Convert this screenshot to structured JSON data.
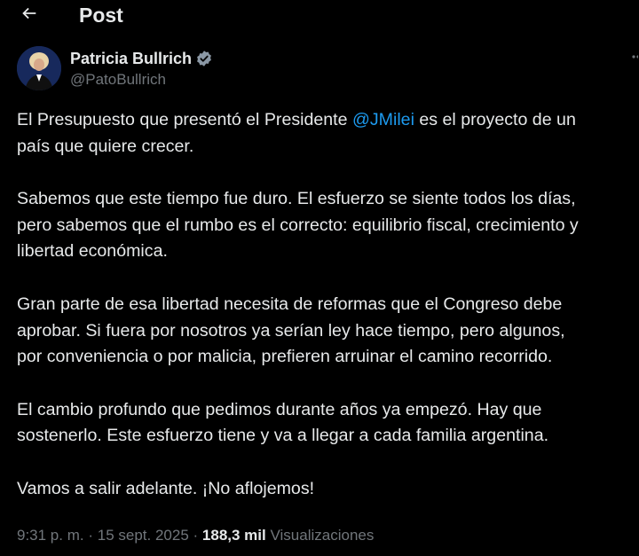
{
  "header": {
    "title": "Post",
    "back_icon": "arrow-left-icon"
  },
  "author": {
    "name": "Patricia Bullrich",
    "handle": "@PatoBullrich",
    "verified_icon": "verified-badge-icon",
    "more_icon": "more-options-icon"
  },
  "post": {
    "p1_before": "El Presupuesto que presentó el Presidente ",
    "p1_mention": "@JMilei",
    "p1_after": " es el proyecto de un",
    "p1_line2": "país que quiere crecer.",
    "p2_line1": "Sabemos que este tiempo fue duro. El esfuerzo se siente todos los días,",
    "p2_line2": "pero sabemos que el rumbo es el correcto: equilibrio fiscal, crecimiento y",
    "p2_line3": "libertad económica.",
    "p3_line1": "Gran parte de esa libertad necesita de reformas que el Congreso debe",
    "p3_line2": "aprobar. Si fuera por nosotros ya serían ley hace tiempo, pero algunos,",
    "p3_line3": "por conveniencia o por malicia, prefieren arruinar el camino recorrido.",
    "p4_line1": "El cambio profundo que pedimos durante años ya empezó. Hay que",
    "p4_line2": "sostenerlo. Este esfuerzo tiene y va a llegar a cada familia argentina.",
    "p5_line1": "Vamos a salir adelante. ¡No aflojemos!"
  },
  "meta": {
    "time": "9:31 p. m.",
    "separator": "·",
    "date": "15 sept. 2025",
    "views_count": "188,3 mil",
    "views_label": "Visualizaciones"
  },
  "colors": {
    "background": "#000000",
    "text": "#e7e9ea",
    "muted": "#71767b",
    "accent": "#1d9bf0"
  }
}
